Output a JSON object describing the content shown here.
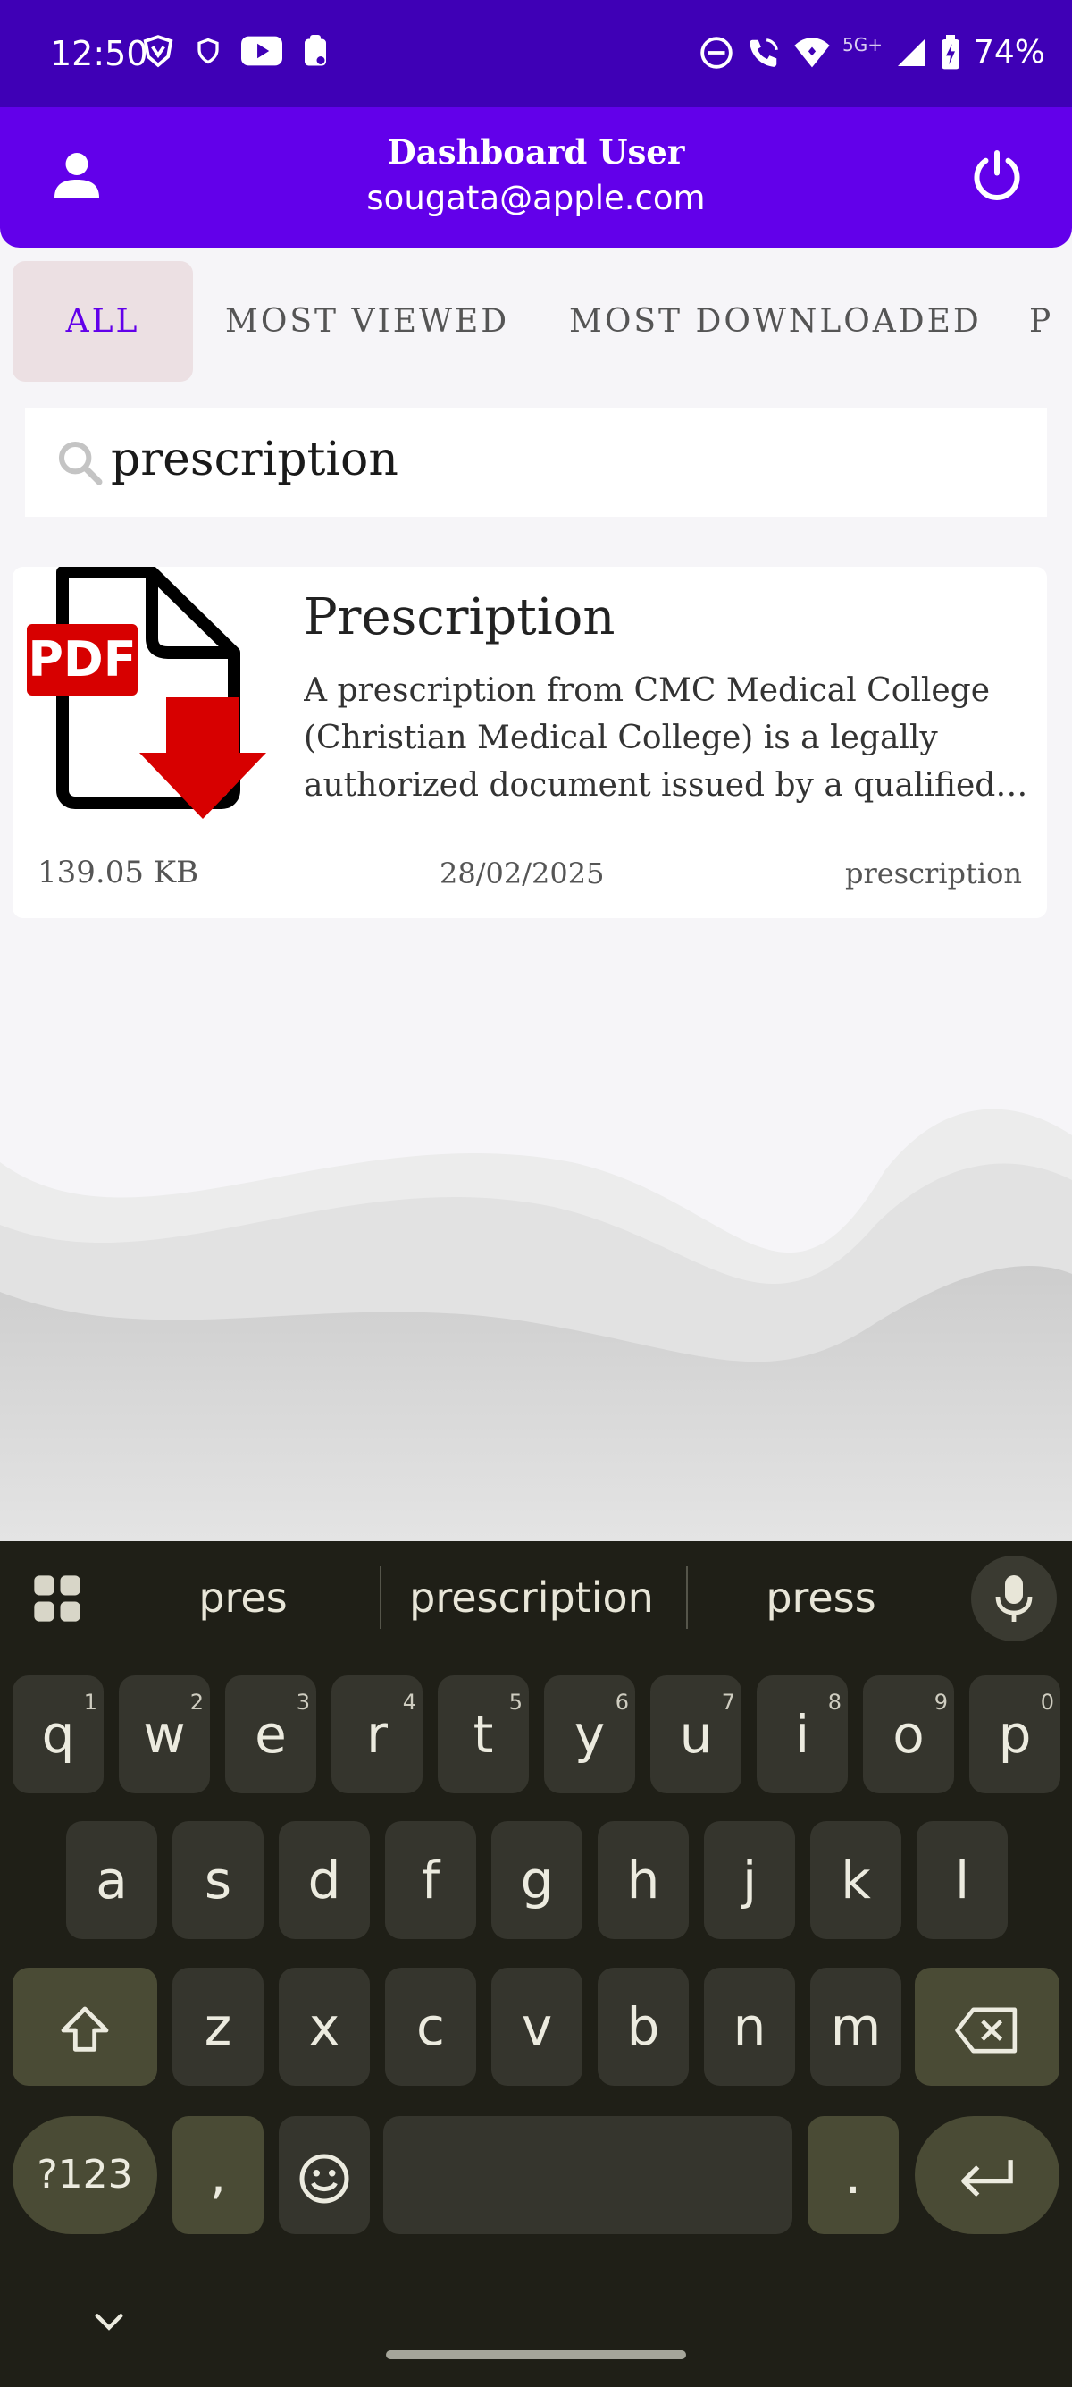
{
  "status_bar": {
    "time": "12:50",
    "network": "5G+",
    "battery": "74%"
  },
  "header": {
    "title": "Dashboard User",
    "email": "sougata@apple.com"
  },
  "tabs": [
    {
      "label": "ALL",
      "active": true
    },
    {
      "label": "MOST VIEWED",
      "active": false
    },
    {
      "label": "MOST DOWNLOADED",
      "active": false
    },
    {
      "label": "P",
      "active": false
    }
  ],
  "search": {
    "value": "prescription"
  },
  "results": [
    {
      "title": "Prescription",
      "description": "A prescription from CMC Medical College (Christian Medical College) is a legally authorized document issued by a qualified…",
      "size": "139.05 KB",
      "date": "28/02/2025",
      "tag": "prescription",
      "icon_text": "PDF"
    }
  ],
  "keyboard": {
    "suggestions": [
      "pres",
      "prescription",
      "press"
    ],
    "row1": [
      {
        "k": "q",
        "h": "1"
      },
      {
        "k": "w",
        "h": "2"
      },
      {
        "k": "e",
        "h": "3"
      },
      {
        "k": "r",
        "h": "4"
      },
      {
        "k": "t",
        "h": "5"
      },
      {
        "k": "y",
        "h": "6"
      },
      {
        "k": "u",
        "h": "7"
      },
      {
        "k": "i",
        "h": "8"
      },
      {
        "k": "o",
        "h": "9"
      },
      {
        "k": "p",
        "h": "0"
      }
    ],
    "row2": [
      "a",
      "s",
      "d",
      "f",
      "g",
      "h",
      "j",
      "k",
      "l"
    ],
    "row3": [
      "z",
      "x",
      "c",
      "v",
      "b",
      "n",
      "m"
    ],
    "symbols_key": "?123",
    "comma_key": ",",
    "period_key": "."
  },
  "colors": {
    "status_bar": "#3f00b6",
    "header": "#6200ea",
    "active_tab_bg": "#ece0e3",
    "pdf_red": "#d70000",
    "keyboard_bg": "#1f1f17"
  }
}
